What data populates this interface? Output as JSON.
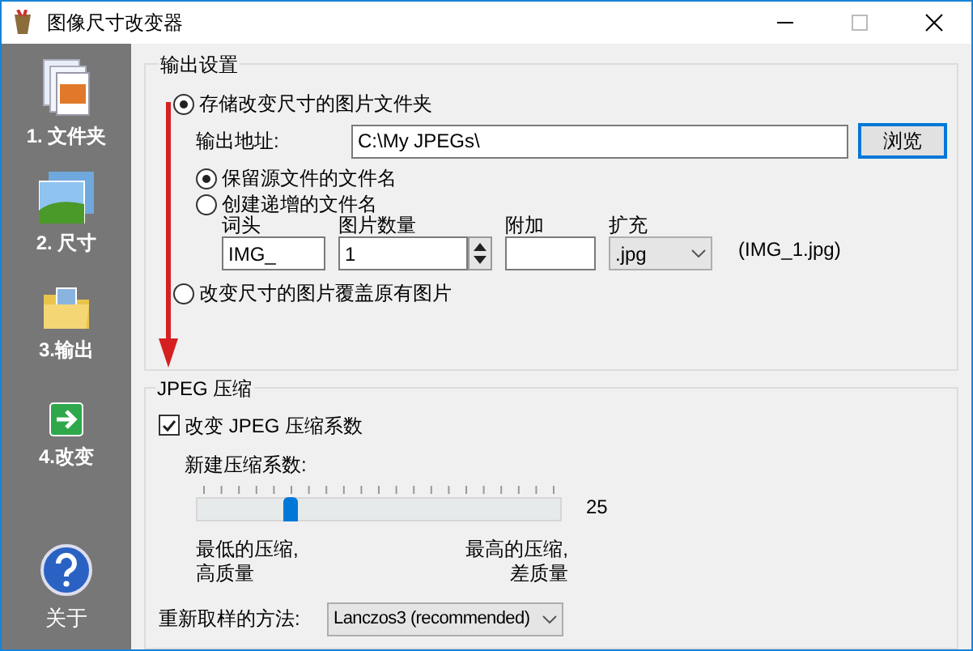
{
  "window": {
    "title": "图像尺寸改变器"
  },
  "sidebar": {
    "items": [
      {
        "label": "1. 文件夹",
        "kind": "folder"
      },
      {
        "label": "2. 尺寸",
        "kind": "size"
      },
      {
        "label": "3.输出",
        "kind": "output"
      },
      {
        "label": "4.改变",
        "kind": "change"
      }
    ],
    "about": {
      "label": "关于"
    }
  },
  "output_settings": {
    "title": "输出设置",
    "destination": [
      {
        "label": "存储改变尺寸的图片文件夹",
        "selected": true
      },
      {
        "label": "改变尺寸的图片覆盖原有图片",
        "selected": false
      }
    ],
    "address_label": "输出地址:",
    "address_value": "C:\\My JPEGs\\",
    "browse_button": "浏览",
    "naming": [
      {
        "label": "保留源文件的文件名",
        "selected": true
      },
      {
        "label": "创建递增的文件名",
        "selected": false
      }
    ],
    "prefix": {
      "label": "词头",
      "value": "IMG_"
    },
    "count": {
      "label": "图片数量",
      "value": "1"
    },
    "suffix": {
      "label": "附加"
    },
    "extension": {
      "label": "扩充",
      "value": ".jpg"
    },
    "example": "(IMG_1.jpg)"
  },
  "jpeg": {
    "title": "JPEG 压缩",
    "change_checkbox": {
      "label": "改变 JPEG 压缩系数",
      "checked": true
    },
    "factor_label": "新建压缩系数:",
    "slider": {
      "level": 0.25
    },
    "reading": "25",
    "low_label": "最低的压缩,\n高质量",
    "high_label": "最高的压缩,\n差质量",
    "resample_label": "重新取样的方法:",
    "resample_value": "Lanczos3 (recommended)"
  }
}
